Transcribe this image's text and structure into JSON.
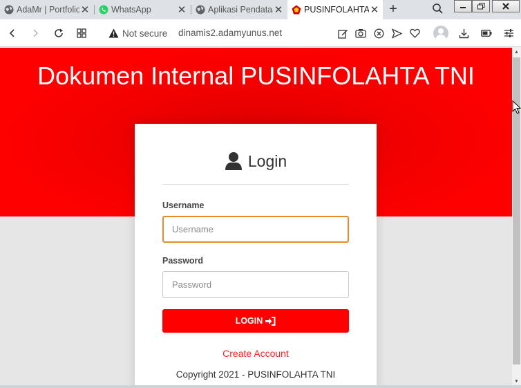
{
  "tabs": [
    {
      "title": "AdaMr | Portfolio",
      "icon": "globe-icon"
    },
    {
      "title": "WhatsApp",
      "icon": "whatsapp-icon"
    },
    {
      "title": "Aplikasi Pendataan",
      "icon": "globe-icon"
    },
    {
      "title": "PUSINFOLAHTA TNI",
      "icon": "pusinfolahta-logo-icon",
      "active": true
    }
  ],
  "address_bar": {
    "security_text": "Not secure",
    "url": "dinamis2.adamyunus.net"
  },
  "page": {
    "hero_title": "Dokumen Internal PUSINFOLAHTA TNI",
    "login_heading": "Login",
    "username_label": "Username",
    "username_placeholder": "Username",
    "username_value": "",
    "password_label": "Password",
    "password_placeholder": "Password",
    "password_value": "",
    "login_button": "LOGIN",
    "create_account": "Create Account",
    "copyright": "Copyright 2021 - PUSINFOLAHTA TNI"
  },
  "colors": {
    "brand_red": "#ff0000",
    "focus_border": "#e88a2a",
    "link_red": "#ff2020"
  }
}
